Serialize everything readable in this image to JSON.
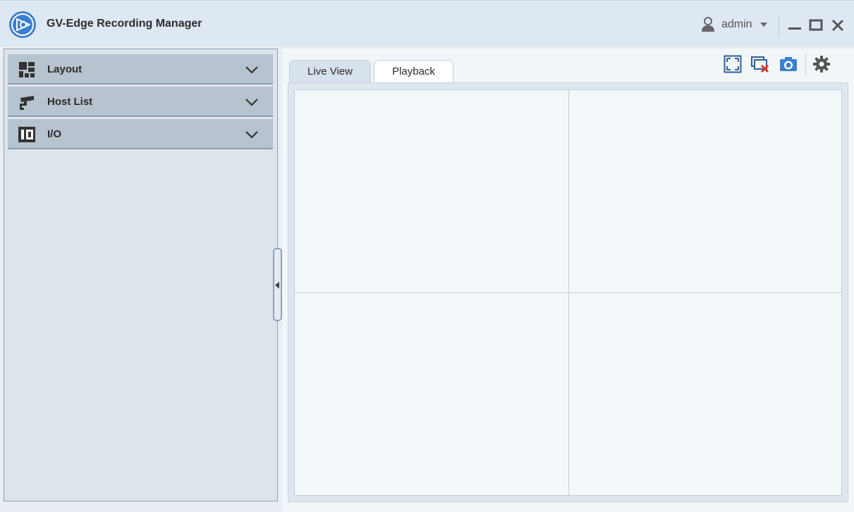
{
  "app": {
    "title": "GV-Edge Recording Manager"
  },
  "user": {
    "name": "admin"
  },
  "sidebar": {
    "items": [
      {
        "label": "Layout",
        "icon": "layout-grid-icon"
      },
      {
        "label": "Host List",
        "icon": "camera-icon"
      },
      {
        "label": "I/O",
        "icon": "io-icon"
      }
    ]
  },
  "tabs": [
    {
      "label": "Live View",
      "active": false
    },
    {
      "label": "Playback",
      "active": true
    }
  ],
  "toolbar": {
    "buttons": [
      "fullscreen-icon",
      "close-all-views-icon",
      "snapshot-icon",
      "settings-icon"
    ]
  },
  "colors": {
    "accent": "#3a7fd0",
    "titlebar_bg": "#dde8f3",
    "accordion_bg": "#b7c3cf",
    "close_red": "#e03030"
  }
}
